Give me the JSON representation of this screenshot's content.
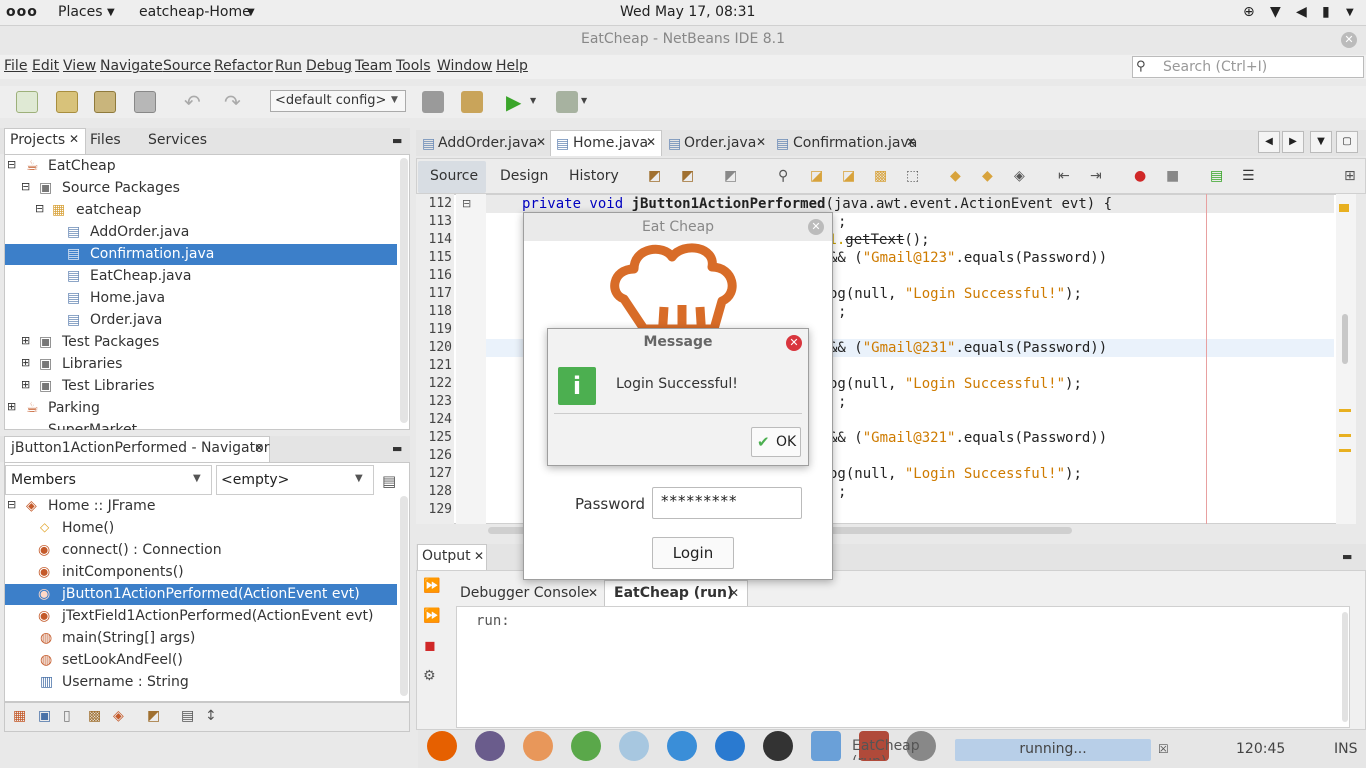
{
  "topbar": {
    "activities": "ooo",
    "places": "Places",
    "app": "eatcheap-Home",
    "clock": "Wed May 17, 08:31"
  },
  "window": {
    "title": "EatCheap - NetBeans IDE 8.1"
  },
  "menu": [
    "File",
    "Edit",
    "View",
    "Navigate",
    "Source",
    "Refactor",
    "Run",
    "Debug",
    "Team",
    "Tools",
    "Window",
    "Help"
  ],
  "search": {
    "placeholder": "Search (Ctrl+I)"
  },
  "toolbar": {
    "config": "<default config>"
  },
  "projects": {
    "tabs": [
      "Projects",
      "Files",
      "Services"
    ],
    "tree": [
      {
        "label": "EatCheap"
      },
      {
        "label": "Source Packages"
      },
      {
        "label": "eatcheap"
      },
      {
        "label": "AddOrder.java"
      },
      {
        "label": "Confirmation.java"
      },
      {
        "label": "EatCheap.java"
      },
      {
        "label": "Home.java"
      },
      {
        "label": "Order.java"
      },
      {
        "label": "Test Packages"
      },
      {
        "label": "Libraries"
      },
      {
        "label": "Test Libraries"
      },
      {
        "label": "Parking"
      },
      {
        "label": "SuperMarket"
      }
    ]
  },
  "navigator": {
    "title": "jButton1ActionPerformed - Navigator",
    "filter": "Members",
    "empty": "<empty>",
    "items": [
      "Home :: JFrame",
      "Home()",
      "connect() : Connection",
      "initComponents()",
      "jButton1ActionPerformed(ActionEvent evt)",
      "jTextField1ActionPerformed(ActionEvent evt)",
      "main(String[] args)",
      "setLookAndFeel()",
      "Username : String"
    ]
  },
  "editor": {
    "tabs": [
      "AddOrder.java",
      "Home.java",
      "Order.java",
      "Confirmation.java"
    ],
    "subtabs": [
      "Source",
      "Design",
      "History"
    ],
    "lines": [
      "112",
      "113",
      "114",
      "115",
      "116",
      "117",
      "118",
      "119",
      "120",
      "121",
      "122",
      "123",
      "124",
      "125",
      "126",
      "127",
      "128",
      "129"
    ],
    "code": {
      "l112a": "private void ",
      "l112b": "jButton1ActionPerformed",
      "l112c": "(java.awt.event.ActionEvent evt) {",
      "l113": ";",
      "l114a": "d1.",
      "l114b": "getText",
      "l114c": "();",
      "l115a": "&& (",
      "l115b": "\"Gmail@123\"",
      "l115c": ".equals(Password))",
      "l117a": "og(null, ",
      "l117b": "\"Login Successful!\"",
      "l117c": ");",
      "l118": ";",
      "l120a": "&& (",
      "l120b": "\"Gmail@231\"",
      "l120c": ".equals(Password))",
      "l122a": "og(null, ",
      "l122b": "\"Login Successful!\"",
      "l122c": ");",
      "l123": ";",
      "l125a": "&& (",
      "l125b": "\"Gmail@321\"",
      "l125c": ".equals(Password))",
      "l127a": "og(null, ",
      "l127b": "\"Login Successful!\"",
      "l127c": ");",
      "l128": ";"
    }
  },
  "output": {
    "title": "Output",
    "tabs": [
      "Debugger Console",
      "EatCheap (run)"
    ],
    "text": "run:"
  },
  "app_window": {
    "title": "Eat Cheap",
    "password_label": "Password",
    "password_value": "*********",
    "login_label": "Login"
  },
  "message": {
    "title": "Message",
    "text": "Login Successful!",
    "ok": "OK"
  },
  "status": {
    "progress": "running...",
    "position": "120:45",
    "mode": "INS",
    "task": "EatCheap (run)"
  }
}
